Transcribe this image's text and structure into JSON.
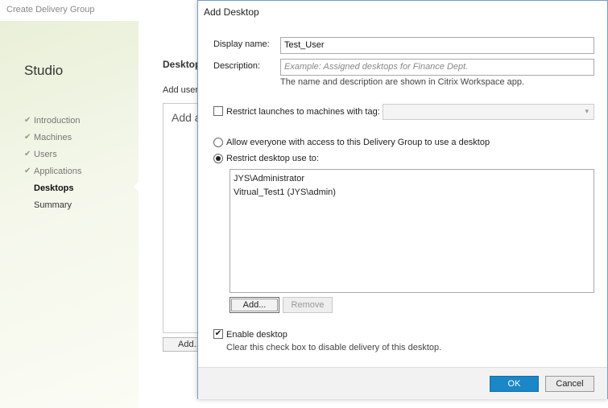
{
  "window": {
    "title": "Create Delivery Group"
  },
  "sidebar": {
    "app_name": "Studio",
    "steps": [
      {
        "label": "Introduction",
        "state": "done"
      },
      {
        "label": "Machines",
        "state": "done"
      },
      {
        "label": "Users",
        "state": "done"
      },
      {
        "label": "Applications",
        "state": "done"
      },
      {
        "label": "Desktops",
        "state": "current"
      },
      {
        "label": "Summary",
        "state": "pending"
      }
    ]
  },
  "main": {
    "heading": "Desktop",
    "subtitle": "Add users",
    "box_text": "Add a",
    "add_button": "Add..."
  },
  "dialog": {
    "title": "Add Desktop",
    "display_name_label": "Display name:",
    "display_name_value": "Test_User",
    "description_label": "Description:",
    "description_placeholder": "Example: Assigned desktops for Finance Dept.",
    "name_hint": "The name and description are shown in Citrix Workspace app.",
    "restrict_tag_label": "Restrict launches to machines with tag:",
    "restrict_tag_checked": false,
    "allow_everyone_label": "Allow everyone with access to this Delivery Group to use a desktop",
    "restrict_use_label": "Restrict desktop use to:",
    "selected_option": "restrict",
    "users": [
      "JYS\\Administrator",
      "Vitrual_Test1 (JYS\\admin)"
    ],
    "add_button": "Add...",
    "remove_button": "Remove",
    "enable_label": "Enable desktop",
    "enable_checked": true,
    "enable_hint": "Clear this check box to disable delivery of this desktop.",
    "ok_button": "OK",
    "cancel_button": "Cancel"
  },
  "icons": {
    "check": "checkmark-icon",
    "dropdown": "chevron-down-icon"
  },
  "colors": {
    "primary": "#1b86c8",
    "step_check": "#8aa070"
  }
}
